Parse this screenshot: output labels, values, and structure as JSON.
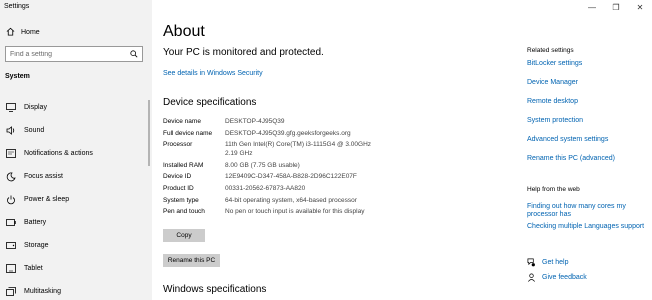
{
  "window": {
    "title": "Settings",
    "controls": [
      "—",
      "❐",
      "✕"
    ]
  },
  "sidebar": {
    "home_label": "Home",
    "search_placeholder": "Find a setting",
    "section_title": "System",
    "items": [
      {
        "label": "Display",
        "icon": "display-icon"
      },
      {
        "label": "Sound",
        "icon": "sound-icon"
      },
      {
        "label": "Notifications & actions",
        "icon": "notifications-icon"
      },
      {
        "label": "Focus assist",
        "icon": "focus-assist-icon"
      },
      {
        "label": "Power & sleep",
        "icon": "power-icon"
      },
      {
        "label": "Battery",
        "icon": "battery-icon"
      },
      {
        "label": "Storage",
        "icon": "storage-icon"
      },
      {
        "label": "Tablet",
        "icon": "tablet-icon"
      },
      {
        "label": "Multitasking",
        "icon": "multitasking-icon"
      }
    ]
  },
  "main": {
    "title": "About",
    "protection_text": "Your PC is monitored and protected.",
    "security_link": "See details in Windows Security",
    "device_specs_title": "Device specifications",
    "specs": [
      {
        "label": "Device name",
        "value": "DESKTOP-4J95Q39"
      },
      {
        "label": "Full device name",
        "value": "DESKTOP-4J95Q39.gfg.geeksforgeeks.org"
      },
      {
        "label": "Processor",
        "value": "11th Gen Intel(R) Core(TM) i3-1115G4 @ 3.00GHz   2.19 GHz"
      },
      {
        "label": "Installed RAM",
        "value": "8.00 GB (7.75 GB usable)"
      },
      {
        "label": "Device ID",
        "value": "12E9409C-D347-458A-B828-2D96C122E07F"
      },
      {
        "label": "Product ID",
        "value": "00331-20562-67873-AA820"
      },
      {
        "label": "System type",
        "value": "64-bit operating system, x64-based processor"
      },
      {
        "label": "Pen and touch",
        "value": "No pen or touch input is available for this display"
      }
    ],
    "copy_button": "Copy",
    "rename_button": "Rename this PC",
    "windows_specs_title": "Windows specifications"
  },
  "related": {
    "title": "Related settings",
    "links": [
      "BitLocker settings",
      "Device Manager",
      "Remote desktop",
      "System protection",
      "Advanced system settings",
      "Rename this PC (advanced)"
    ]
  },
  "help": {
    "title": "Help from the web",
    "links": [
      "Finding out how many cores my processor has",
      "Checking multiple Languages support"
    ],
    "get_help": "Get help",
    "give_feedback": "Give feedback"
  },
  "colors": {
    "link": "#0063b1",
    "sidebar_bg": "#f2f2f2",
    "button_bg": "#cccccc"
  }
}
